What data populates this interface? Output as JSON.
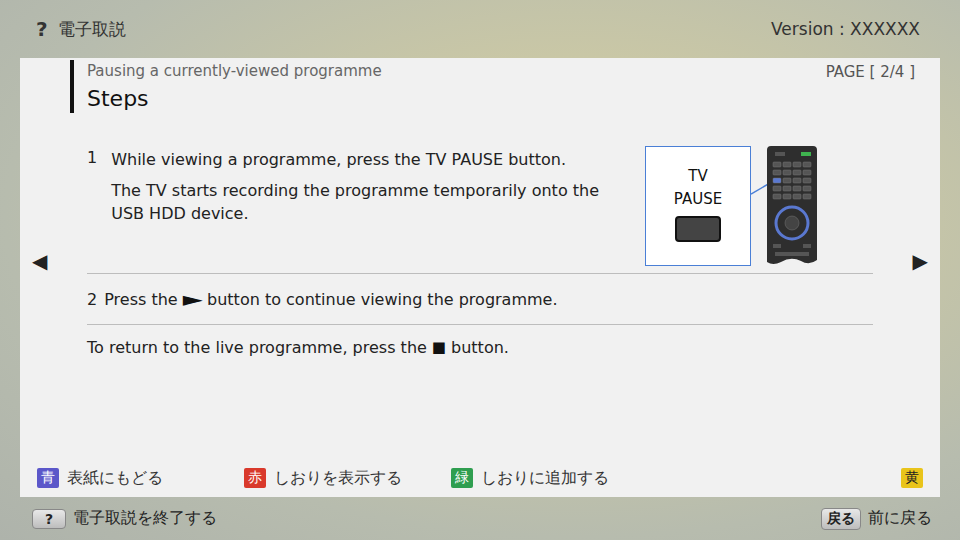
{
  "header": {
    "help_key": "?",
    "title": "電子取説",
    "version": "Version : XXXXXX"
  },
  "page": {
    "breadcrumb": "Pausing a currently-viewed programme",
    "heading": "Steps",
    "page_indicator": "PAGE [ 2/4 ]",
    "prev_arrow": "◀",
    "next_arrow": "▶"
  },
  "step1": {
    "number": "1",
    "text": "While viewing a programme, press the TV PAUSE button.",
    "detail": "The TV starts recording the programme temporarily onto the USB HDD device.",
    "callout_lines": [
      "TV",
      "PAUSE"
    ]
  },
  "step2": {
    "number": "2",
    "before": "Press the",
    "symbol": "►",
    "after": "button to continue viewing the programme."
  },
  "note": {
    "before": "To return to the live programme, press the",
    "symbol": "■",
    "after": "button."
  },
  "color_keys": [
    {
      "key": "青",
      "label": "表紙にもどる",
      "color": "#5b57c9"
    },
    {
      "key": "赤",
      "label": "しおりを表示する",
      "color": "#d9392b"
    },
    {
      "key": "緑",
      "label": "しおりに追加する",
      "color": "#2f9e50"
    },
    {
      "key": "黄",
      "label": "",
      "color": "#e9c41b"
    }
  ],
  "footer": {
    "left": {
      "key": "?",
      "label": "電子取説を終了する"
    },
    "right": {
      "key": "戻る",
      "label": "前に戻る"
    }
  }
}
